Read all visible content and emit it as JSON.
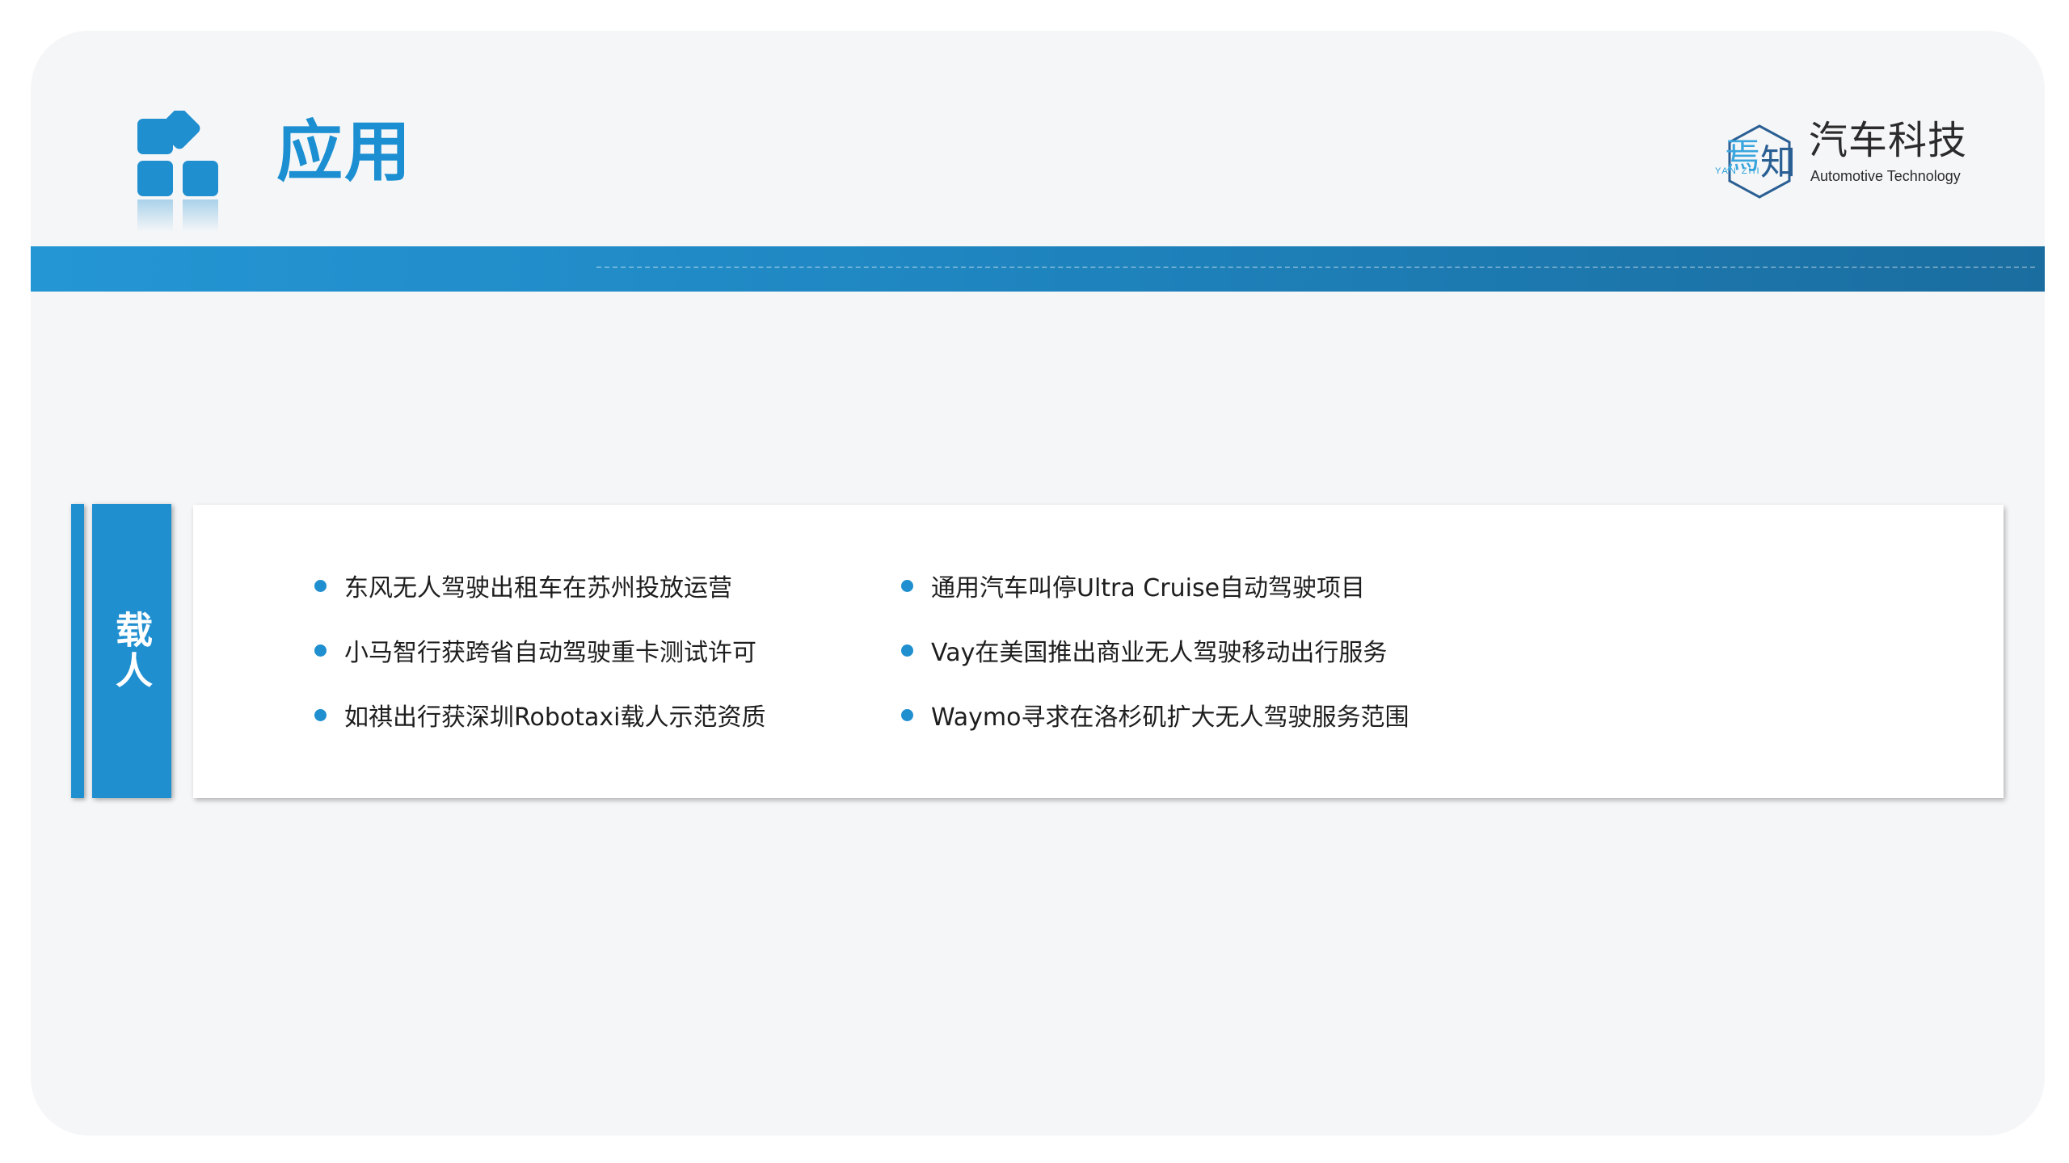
{
  "header": {
    "title": "应用"
  },
  "logo": {
    "mark_text": "YAN ZHI",
    "name_cn": "汽车科技",
    "name_en": "Automotive Technology"
  },
  "section": {
    "tab_label": "载人",
    "items_left": [
      "东风无人驾驶出租车在苏州投放运营",
      "小马智行获跨省自动驾驶重卡测试许可",
      "如祺出行获深圳Robotaxi载人示范资质"
    ],
    "items_right": [
      "通用汽车叫停Ultra Cruise自动驾驶项目",
      "Vay在美国推出商业无人驾驶移动出行服务",
      "Waymo寻求在洛杉矶扩大无人驾驶服务范围"
    ]
  },
  "colors": {
    "accent": "#1f8fd0",
    "band_start": "#2496d4",
    "band_end": "#1a6d9f",
    "background": "#f5f6f8"
  }
}
